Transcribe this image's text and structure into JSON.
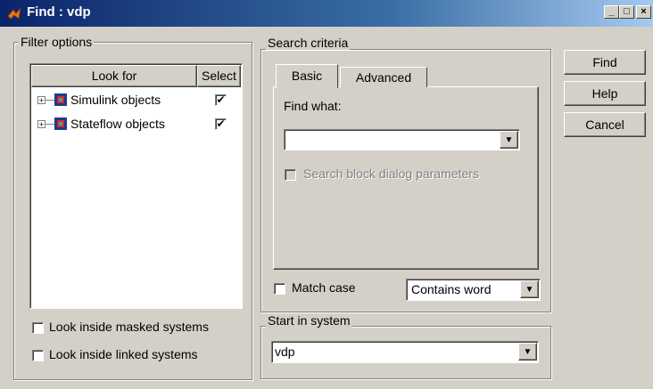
{
  "window": {
    "title": "Find : vdp",
    "app_icon": "matlab-icon",
    "controls": {
      "minimize": "_",
      "maximize": "□",
      "close": "×"
    }
  },
  "filter_options": {
    "legend": "Filter options",
    "columns": [
      "Look for",
      "Select"
    ],
    "items": [
      {
        "label": "Simulink objects",
        "checked": true,
        "icon": "simulink-icon"
      },
      {
        "label": "Stateflow objects",
        "checked": true,
        "icon": "stateflow-icon"
      }
    ],
    "masked_label": "Look inside masked systems",
    "linked_label": "Look inside linked systems",
    "masked_checked": false,
    "linked_checked": false
  },
  "search_criteria": {
    "legend": "Search criteria",
    "tabs": [
      "Basic",
      "Advanced"
    ],
    "active_tab": "Basic",
    "find_what_label": "Find what:",
    "find_what_value": "",
    "search_dialog_label": "Search block dialog parameters",
    "match_case_label": "Match case",
    "match_mode": "Contains word"
  },
  "start_in_system": {
    "legend": "Start in system",
    "value": "vdp"
  },
  "buttons": {
    "find": "Find",
    "help": "Help",
    "cancel": "Cancel"
  },
  "check_mark": "✔",
  "arrow_glyph": "▼",
  "tree_expander": "+"
}
